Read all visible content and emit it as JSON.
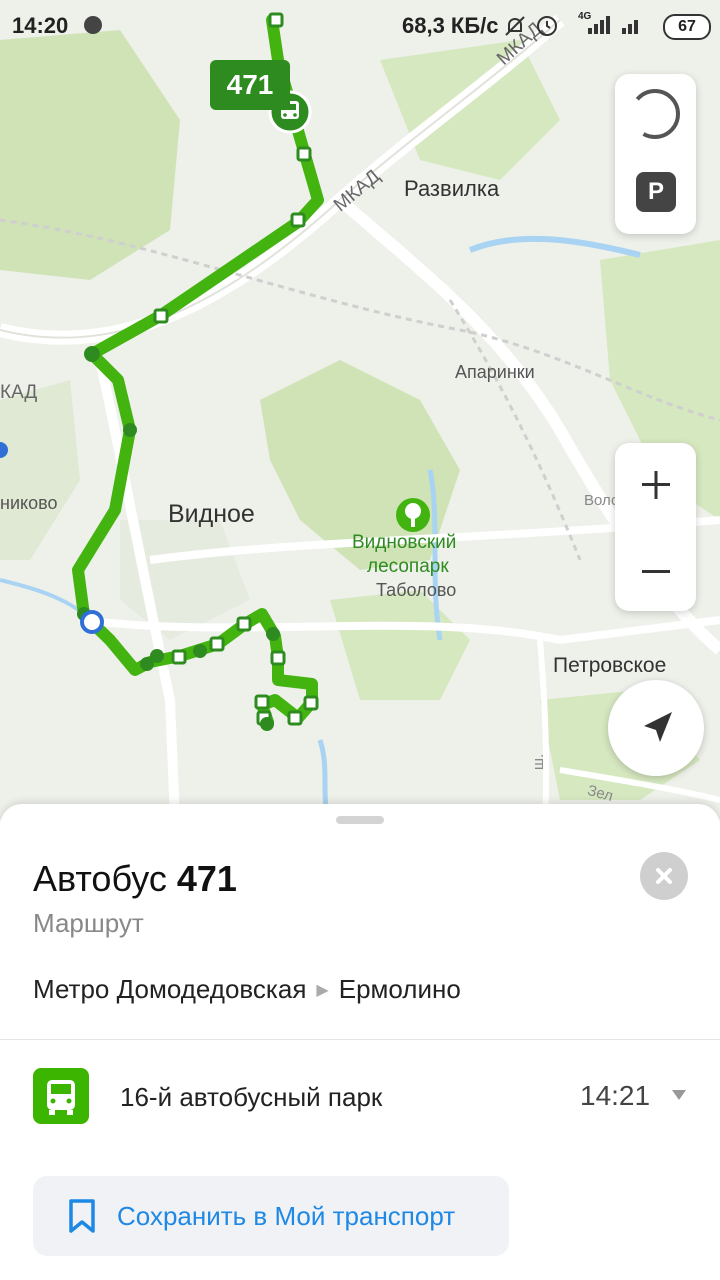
{
  "status_bar": {
    "time": "14:20",
    "network_speed": "68,3 КБ/с",
    "network_type": "4G",
    "battery": "67"
  },
  "map": {
    "route_badge": "471",
    "labels": {
      "mkad_top": "МКАД",
      "mkad_mid": "МКАД",
      "mkad_left": "КАД",
      "razvilka": "Развилка",
      "aparinki": "Апаринки",
      "vidnoe": "Видное",
      "lesopark_line1": "Видновский",
      "lesopark_line2": "лесопарк",
      "tabolovo": "Таболово",
      "petrovskoe": "Петровское",
      "volodarskoe": "Володарское ш.",
      "nikovo": "никово",
      "sh_vertical": "ш.",
      "zel": "Зел"
    },
    "colors": {
      "route": "#43b310",
      "route_dark": "#2e8b1f",
      "forest": "#cfe3b6",
      "water": "#a9d3f2",
      "road": "#ffffff"
    }
  },
  "sheet": {
    "title_prefix": "Автобус",
    "title_number": "471",
    "subtitle": "Маршрут",
    "route_from": "Метро Домодедовская",
    "route_to": "Ермолино",
    "stop": {
      "name": "16-й автобусный парк",
      "time": "14:21"
    },
    "save_label": "Сохранить в Мой транспорт"
  },
  "icons": [
    "bus-icon",
    "parking-icon",
    "traffic-icon",
    "zoom-in-icon",
    "zoom-out-icon",
    "locate-arrow-icon",
    "close-icon",
    "bookmark-icon",
    "chevron-down-icon"
  ]
}
